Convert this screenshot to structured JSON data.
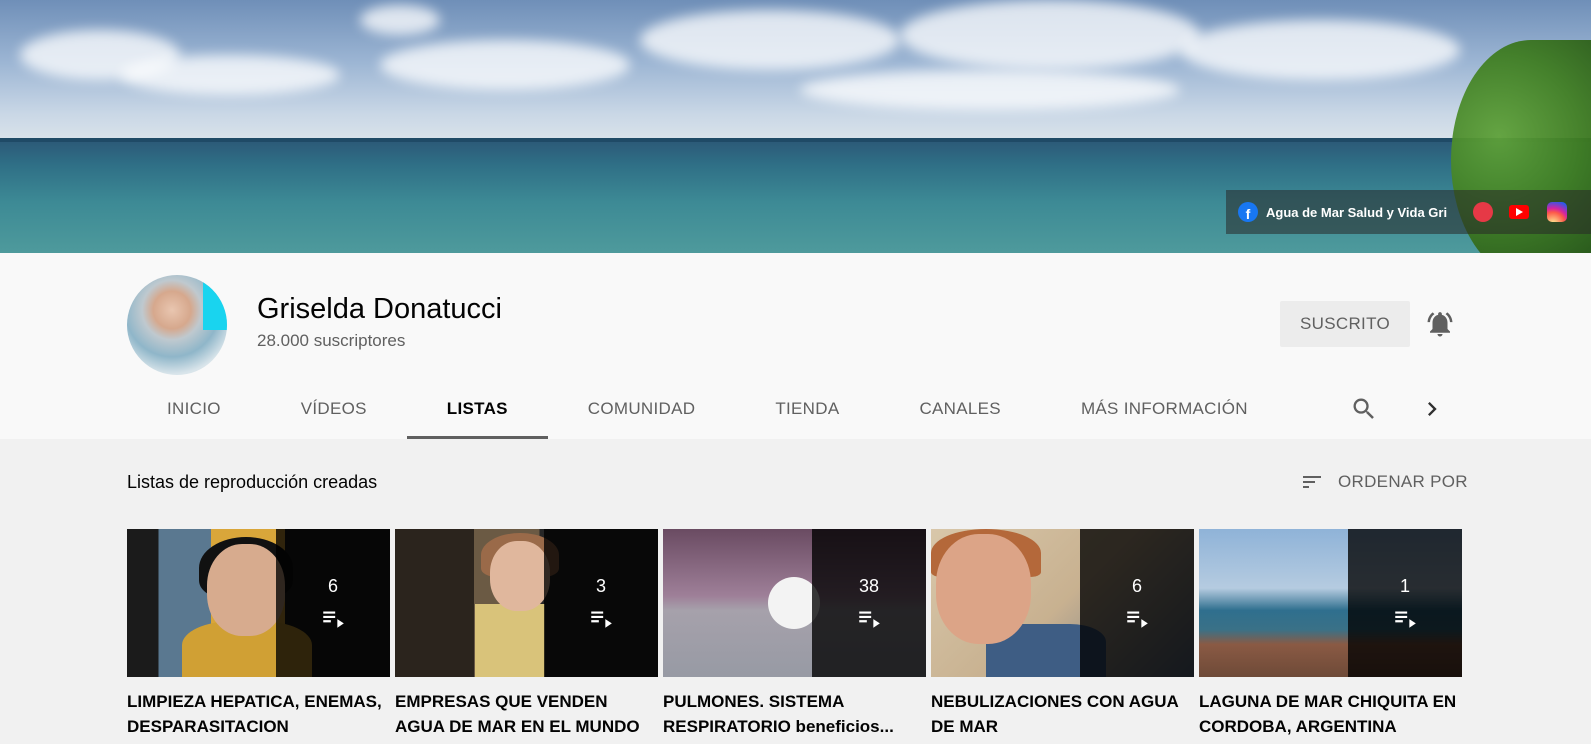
{
  "banner": {
    "link_text": "Agua de Mar Salud y Vida Gri"
  },
  "channel": {
    "name": "Griselda Donatucci",
    "subscribers": "28.000 suscriptores",
    "subscribe_label": "SUSCRITO"
  },
  "tabs": [
    {
      "label": "INICIO"
    },
    {
      "label": "VÍDEOS"
    },
    {
      "label": "LISTAS",
      "active": true
    },
    {
      "label": "COMUNIDAD"
    },
    {
      "label": "TIENDA"
    },
    {
      "label": "CANALES"
    },
    {
      "label": "MÁS INFORMACIÓN"
    }
  ],
  "section": {
    "title": "Listas de reproducción creadas",
    "sort_label": "ORDENAR POR"
  },
  "playlists": [
    {
      "count": "6",
      "title_line1": "LIMPIEZA HEPATICA, ENEMAS,",
      "title_line2": "DESPARASITACION"
    },
    {
      "count": "3",
      "title_line1": "EMPRESAS QUE VENDEN",
      "title_line2": "AGUA DE MAR EN EL MUNDO"
    },
    {
      "count": "38",
      "title_line1": "PULMONES. SISTEMA",
      "title_line2": "RESPIRATORIO beneficios..."
    },
    {
      "count": "6",
      "title_line1": "NEBULIZACIONES CON AGUA",
      "title_line2": "DE MAR"
    },
    {
      "count": "1",
      "title_line1": "LAGUNA DE MAR CHIQUITA EN",
      "title_line2": "CORDOBA, ARGENTINA"
    }
  ],
  "colors": {
    "facebook": "#1877f2",
    "youtube": "#ff0000",
    "text_primary": "#030303",
    "text_secondary": "#606060"
  }
}
